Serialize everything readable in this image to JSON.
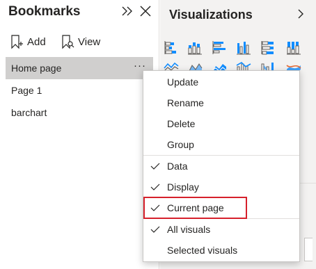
{
  "bookmarks": {
    "title": "Bookmarks",
    "toolbar": {
      "add_label": "Add",
      "view_label": "View"
    },
    "items": [
      {
        "label": "Home page",
        "selected": true,
        "more": "···"
      },
      {
        "label": "Page 1",
        "selected": false
      },
      {
        "label": "barchart",
        "selected": false
      }
    ]
  },
  "visualizations": {
    "title": "Visualizations",
    "icons": [
      "stacked-bar-chart-icon",
      "stacked-column-chart-icon",
      "clustered-bar-chart-icon",
      "clustered-column-chart-icon",
      "100-stacked-bar-chart-icon",
      "100-stacked-column-chart-icon",
      "line-chart-icon",
      "area-chart-icon",
      "stacked-area-chart-icon",
      "line-and-column-chart-icon",
      "ribbon-chart-icon",
      "waterfall-chart-icon"
    ]
  },
  "context_menu": {
    "items": [
      {
        "label": "Update",
        "checked": false
      },
      {
        "label": "Rename",
        "checked": false
      },
      {
        "label": "Delete",
        "checked": false
      },
      {
        "label": "Group",
        "checked": false
      },
      {
        "label": "Data",
        "checked": true
      },
      {
        "label": "Display",
        "checked": true
      },
      {
        "label": "Current page",
        "checked": true,
        "highlighted": true
      },
      {
        "label": "All visuals",
        "checked": true
      },
      {
        "label": "Selected visuals",
        "checked": false
      }
    ]
  },
  "colors": {
    "accent_blue": "#118dff",
    "highlight_red": "#d6202b",
    "selected_bg": "#d0cfce",
    "pane_bg": "#f3f2f1"
  }
}
